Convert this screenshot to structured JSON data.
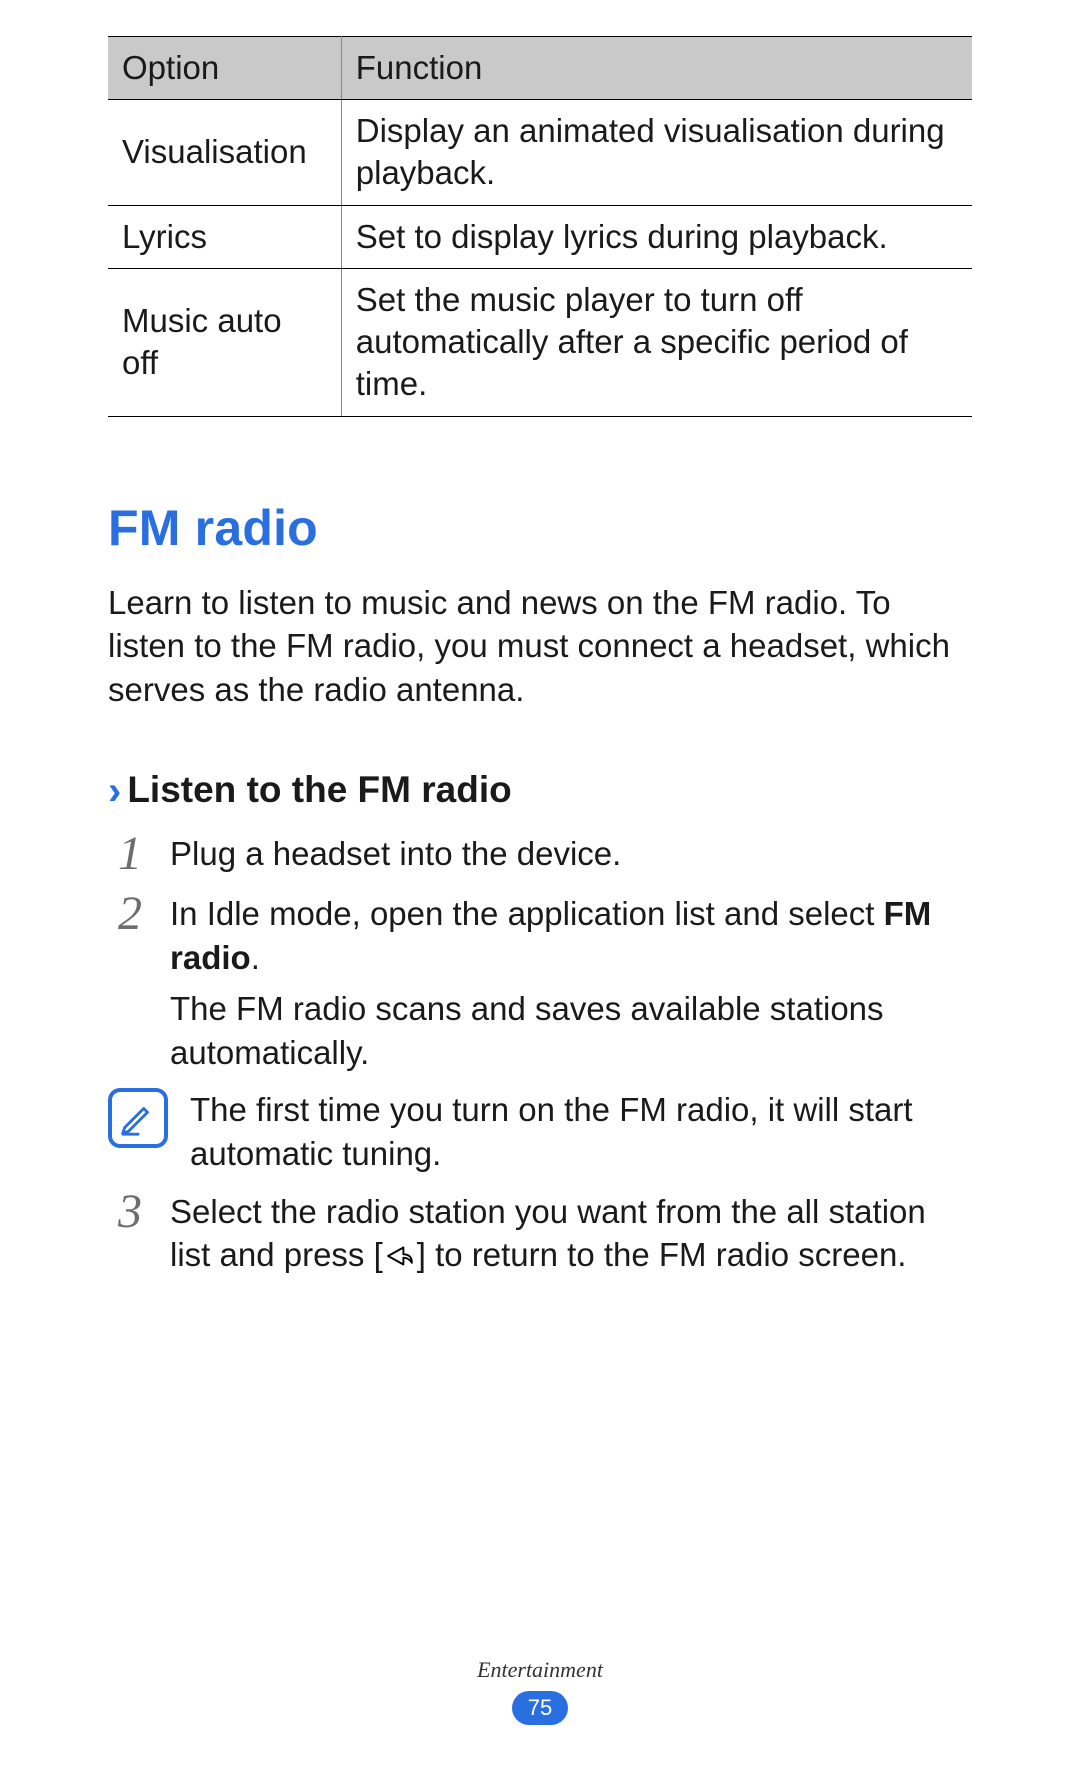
{
  "table": {
    "headers": {
      "option": "Option",
      "function": "Function"
    },
    "rows": [
      {
        "option": "Visualisation",
        "function": "Display an animated visualisation during playback."
      },
      {
        "option": "Lyrics",
        "function": "Set to display lyrics during playback."
      },
      {
        "option": "Music auto off",
        "function": "Set the music player to turn off automatically after a specific period of time."
      }
    ]
  },
  "section_title": "FM radio",
  "intro": "Learn to listen to music and news on the FM radio. To listen to the FM radio, you must connect a headset, which serves as the radio antenna.",
  "sub_chevron": "›",
  "sub_title": "Listen to the FM radio",
  "steps": {
    "s1": {
      "num": "1",
      "text": "Plug a headset into the device."
    },
    "s2": {
      "num": "2",
      "line1a": "In Idle mode, open the application list and select ",
      "line1b_bold": "FM radio",
      "line1c": ".",
      "line2": "The FM radio scans and saves available stations automatically."
    },
    "s3": {
      "num": "3",
      "partA": "Select the radio station you want from the all station list and press [",
      "partB": "] to return to the FM radio screen."
    }
  },
  "note_text": "The first time you turn on the FM radio, it will start automatic tuning.",
  "footer": {
    "section": "Entertainment",
    "page": "75"
  }
}
